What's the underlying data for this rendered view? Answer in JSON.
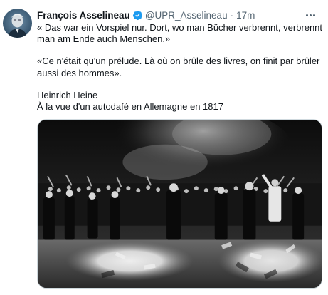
{
  "tweet": {
    "author_name": "François Asselineau",
    "handle": "@UPR_Asselineau",
    "separator": "·",
    "time": "17m",
    "lines": {
      "german": "« Das war ein Vorspiel nur. Dort, wo man Bücher verbrennt, verbrennt man am Ende auch Menschen.»",
      "french": "«Ce n'était qu'un prélude. Là où on brûle des livres, on finit par brûler aussi des hommes».",
      "author": "Heinrich Heine",
      "context": "À la vue d'un autodafé en Allemagne en 1817"
    }
  },
  "icons": {
    "verified": "verified-badge-icon",
    "more": "more-options-icon"
  },
  "colors": {
    "text": "#0f1419",
    "secondary": "#536471",
    "verified": "#1d9bf0",
    "border": "#cfd9de"
  }
}
